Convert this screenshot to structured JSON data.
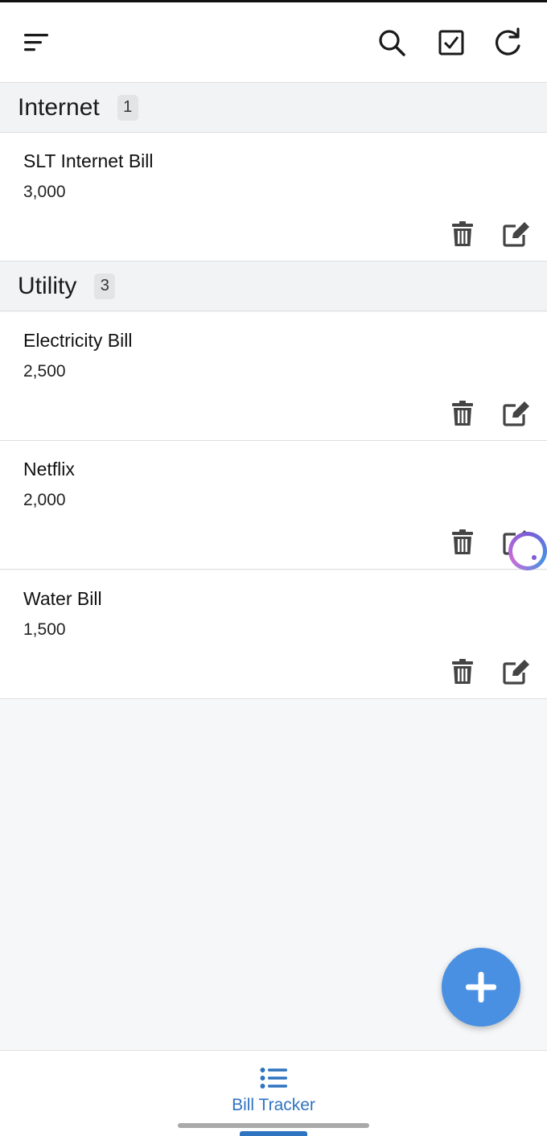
{
  "app": {
    "nav_label": "Bill Tracker",
    "accent_color": "#2f74c0",
    "fab_color": "#4a90e2"
  },
  "toolbar": {
    "icons": [
      "sort-icon",
      "search-icon",
      "checkbox-icon",
      "refresh-icon"
    ]
  },
  "sections": [
    {
      "title": "Internet",
      "count": "1",
      "bills": [
        {
          "name": "SLT Internet Bill",
          "amount": "3,000"
        }
      ]
    },
    {
      "title": "Utility",
      "count": "3",
      "bills": [
        {
          "name": "Electricity Bill",
          "amount": "2,500"
        },
        {
          "name": "Netflix",
          "amount": "2,000"
        },
        {
          "name": "Water Bill",
          "amount": "1,500"
        }
      ]
    }
  ],
  "card_actions": {
    "delete_icon": "trash-icon",
    "edit_icon": "edit-icon"
  },
  "fab": {
    "icon": "plus-icon"
  }
}
